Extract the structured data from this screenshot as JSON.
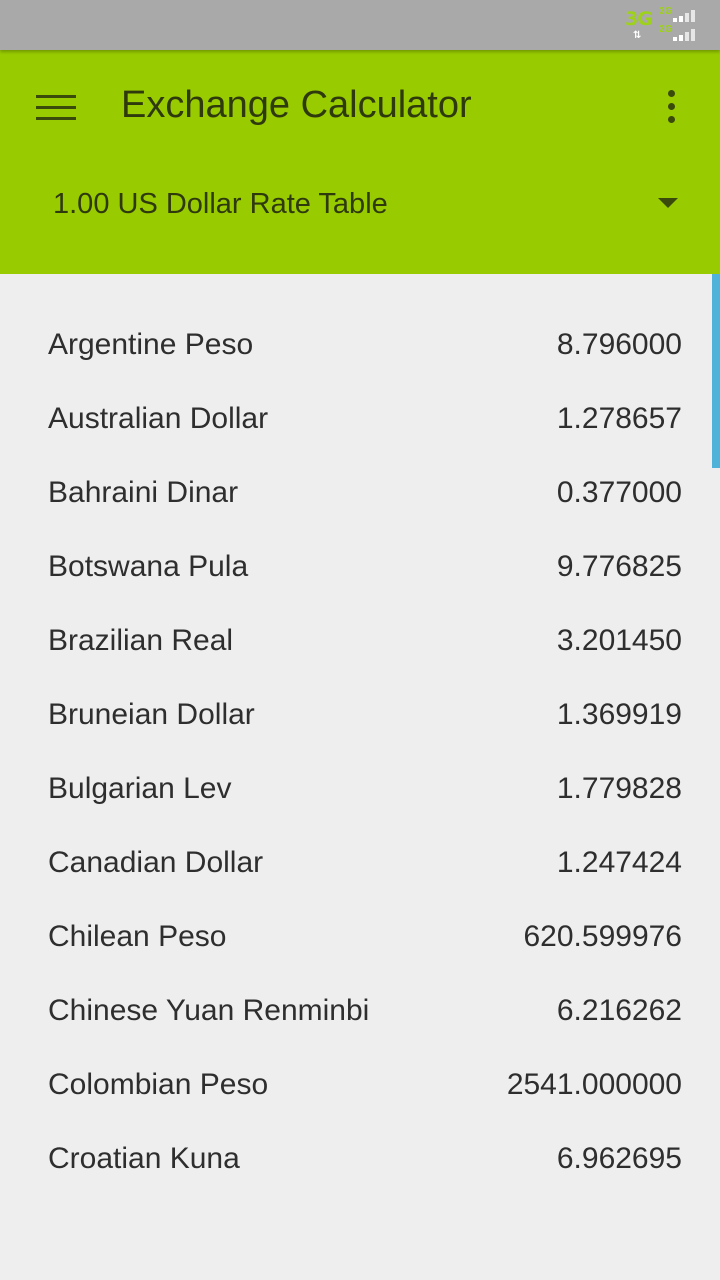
{
  "status_bar": {
    "network_type": "3G",
    "data_arrows": "⇅",
    "sim1_label": "3G",
    "sim2_label": "2G",
    "accent_color": "#9ed11a",
    "sim1_signal_bars": 2,
    "sim2_signal_bars": 2
  },
  "app_bar": {
    "menu_icon": "hamburger-menu-icon",
    "title": "Exchange Calculator",
    "overflow_icon": "more-vertical-icon",
    "color": "#99cc00"
  },
  "rate_selector": {
    "label": "1.00 US Dollar Rate Table",
    "dropdown_icon": "dropdown-arrow-icon"
  },
  "rates": [
    {
      "currency": "Argentine Peso",
      "value": "8.796000"
    },
    {
      "currency": "Australian Dollar",
      "value": "1.278657"
    },
    {
      "currency": "Bahraini Dinar",
      "value": "0.377000"
    },
    {
      "currency": "Botswana Pula",
      "value": "9.776825"
    },
    {
      "currency": "Brazilian Real",
      "value": "3.201450"
    },
    {
      "currency": "Bruneian Dollar",
      "value": "1.369919"
    },
    {
      "currency": "Bulgarian Lev",
      "value": "1.779828"
    },
    {
      "currency": "Canadian Dollar",
      "value": "1.247424"
    },
    {
      "currency": "Chilean Peso",
      "value": "620.599976"
    },
    {
      "currency": "Chinese Yuan Renminbi",
      "value": "6.216262"
    },
    {
      "currency": "Colombian Peso",
      "value": "2541.000000"
    },
    {
      "currency": "Croatian Kuna",
      "value": "6.962695"
    }
  ],
  "scrollbar_color": "#4fb3d9"
}
